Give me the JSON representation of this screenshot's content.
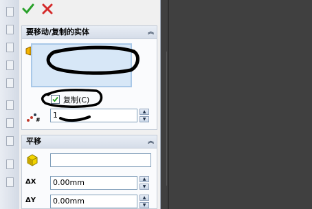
{
  "actions": {
    "ok_icon": "check-icon",
    "cancel_icon": "cross-icon",
    "ok_color": "#2aa12a",
    "cancel_color": "#d42a2a"
  },
  "entities_group": {
    "title": "要移动/复制的实体",
    "copy_label": "复制(C)",
    "copy_checked": true,
    "count_value": "1"
  },
  "translate_group": {
    "title": "平移",
    "reference_value": "",
    "dx_label": "ΔX",
    "dx_value": "0.00mm",
    "dy_label": "ΔY",
    "dy_value": "0.00mm"
  }
}
